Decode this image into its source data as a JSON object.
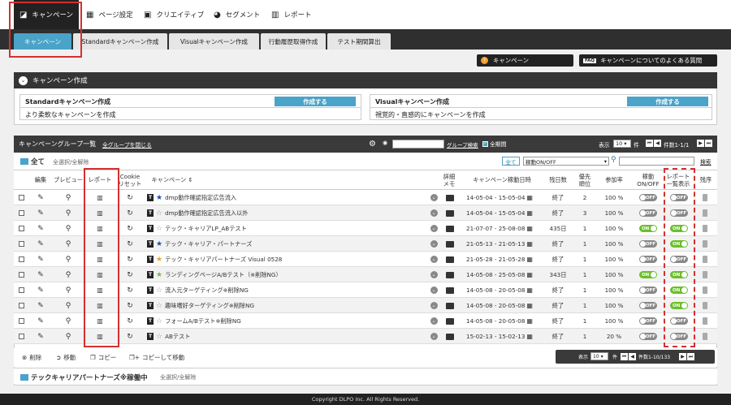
{
  "nav": {
    "items": [
      {
        "label": "キャンペーン",
        "icon": "chart-icon",
        "glyph": "◪"
      },
      {
        "label": "ページ設定",
        "icon": "layout-icon",
        "glyph": "▦"
      },
      {
        "label": "クリエイティブ",
        "icon": "image-icon",
        "glyph": "▣"
      },
      {
        "label": "セグメント",
        "icon": "pie-icon",
        "glyph": "◕"
      },
      {
        "label": "レポート",
        "icon": "bar-chart-icon",
        "glyph": "▥"
      }
    ]
  },
  "subnav": {
    "items": [
      "キャンペーン",
      "Standardキャンペーン作成",
      "Visualキャンペーン作成",
      "行動履歴取得作成",
      "テスト期間算出"
    ]
  },
  "header_buttons": {
    "campaign": "キャンペーン",
    "faq_badge": "FAQ",
    "faq": "キャンペーンについてのよくある質問"
  },
  "create": {
    "title": "キャンペーン作成",
    "standard": {
      "title": "Standardキャンペーン作成",
      "button": "作成する",
      "desc": "より柔軟なキャンペーンを作成"
    },
    "visual": {
      "title": "Visualキャンペーン作成",
      "button": "作成する",
      "desc": "視覚的・直感的にキャンペーンを作成"
    }
  },
  "group": {
    "title": "キャンペーングループ一覧",
    "collapse": "全グループを閉じる",
    "group_search": "グループ検索",
    "all_period": "全期間",
    "display": "表示",
    "per_page": "10",
    "unit": "件",
    "count": "件数1-1/1",
    "all_label": "全て",
    "select_all": "全選択/全解除",
    "filter_all": "全て",
    "filter_select": "稼動ON/OFF",
    "search_btn": "検索"
  },
  "table": {
    "headers": [
      "編集",
      "プレビュー",
      "レポート",
      "Cookie\nリセット",
      "キャンペーン ⇕",
      "詳細\nメモ",
      "キャンペーン稼動日時",
      "残日数",
      "優先\n順位",
      "参加率",
      "稼動\nON/OFF",
      "レポート\n一覧表示",
      "残序"
    ],
    "rows": [
      {
        "name": "dmp動作確認指定広告流入",
        "star": "★",
        "star_color": "#1a4fa8",
        "dates": "14-05-04 - 15-05-04",
        "days": "終了",
        "prio": "2",
        "rate": "100 %",
        "on": "OFF",
        "report": "OFF"
      },
      {
        "name": "dmp動作確認指定広告流入以外",
        "star": "☆",
        "star_color": "#999999",
        "dates": "14-05-04 - 15-05-04",
        "days": "終了",
        "prio": "3",
        "rate": "100 %",
        "on": "OFF",
        "report": "OFF"
      },
      {
        "name": "テック・キャリアLP_ABテスト",
        "star": "☆",
        "star_color": "#999999",
        "dates": "21-07-07 - 25-08-08",
        "days": "435日",
        "prio": "1",
        "rate": "100 %",
        "on": "ON",
        "report": "ON"
      },
      {
        "name": "テック・キャリア・パートナーズ",
        "star": "★",
        "star_color": "#1a4fa8",
        "dates": "21-05-13 - 21-05-13",
        "days": "終了",
        "prio": "1",
        "rate": "100 %",
        "on": "OFF",
        "report": "ON"
      },
      {
        "name": "テック・キャリアパートナーズ Visual 0528",
        "star": "★",
        "star_color": "#f0a030",
        "dates": "21-05-28 - 21-05-28",
        "days": "終了",
        "prio": "1",
        "rate": "100 %",
        "on": "OFF",
        "report": "OFF"
      },
      {
        "name": "ランディングページA/Bテスト（※削除NG）",
        "star": "★",
        "star_color": "#7ab648",
        "dates": "14-05-08 - 25-05-08",
        "days": "343日",
        "prio": "1",
        "rate": "100 %",
        "on": "ON",
        "report": "ON"
      },
      {
        "name": "流入元ターゲティング※削除NG",
        "star": "☆",
        "star_color": "#999999",
        "dates": "14-05-08 - 20-05-08",
        "days": "終了",
        "prio": "1",
        "rate": "100 %",
        "on": "OFF",
        "report": "ON"
      },
      {
        "name": "趣味嗜好ターゲティング※削除NG",
        "star": "☆",
        "star_color": "#999999",
        "dates": "14-05-08 - 20-05-08",
        "days": "終了",
        "prio": "1",
        "rate": "100 %",
        "on": "OFF",
        "report": "ON"
      },
      {
        "name": "フォームA/Bテスト※削除NG",
        "star": "☆",
        "star_color": "#999999",
        "dates": "14-05-08 - 20-05-08",
        "days": "終了",
        "prio": "1",
        "rate": "100 %",
        "on": "OFF",
        "report": "OFF"
      },
      {
        "name": "ABテスト",
        "star": "☆",
        "star_color": "#999999",
        "dates": "15-02-13 - 15-02-13",
        "days": "終了",
        "prio": "1",
        "rate": "20 %",
        "on": "OFF",
        "report": "OFF"
      }
    ]
  },
  "actions": {
    "delete": "削除",
    "move": "移動",
    "copy": "コピー",
    "copy_move": "コピーして移動"
  },
  "pager2": {
    "display": "表示",
    "per_page": "10",
    "unit": "件",
    "count": "件数1-10/133"
  },
  "group2": {
    "name": "テックキャリアパートナーズ※稼働中",
    "select_all": "全選択/全解除"
  },
  "footer": "Copyright DLPO Inc. All Rights Reserved.",
  "colors": {
    "accent": "#4aa3c8",
    "on": "#6bbf2a",
    "off": "#888888",
    "highlight": "#d43030"
  }
}
